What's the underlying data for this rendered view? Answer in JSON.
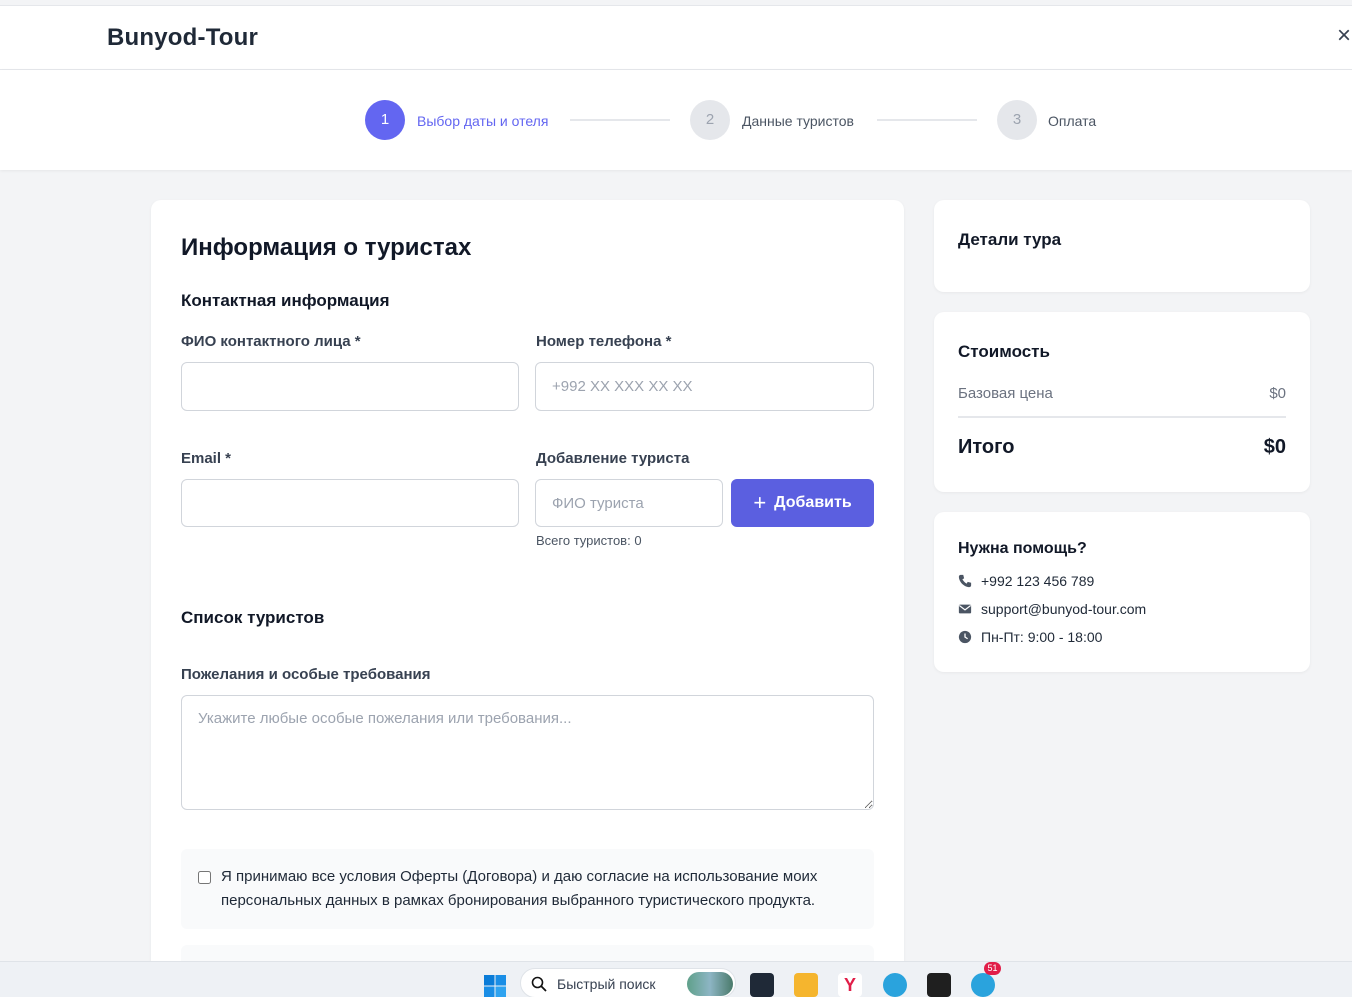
{
  "header": {
    "brand": "Bunyod-Tour",
    "close_icon": "×"
  },
  "stepper": {
    "steps": [
      {
        "number": "1",
        "label": "Выбор даты и отеля",
        "state": "active"
      },
      {
        "number": "2",
        "label": "Данные туристов",
        "state": "inactive"
      },
      {
        "number": "3",
        "label": "Оплата",
        "state": "inactive"
      }
    ]
  },
  "form": {
    "title": "Информация о туристах",
    "contact_heading": "Контактная информация",
    "fio_label": "ФИО контактного лица *",
    "fio_value": "",
    "phone_label": "Номер телефона *",
    "phone_placeholder": "+992 XX XXX XX XX",
    "email_label": "Email *",
    "email_value": "",
    "add_tourist_label": "Добавление туриста",
    "tourist_name_placeholder": "ФИО туриста",
    "add_button": "Добавить",
    "total_tourists": "Всего туристов: 0",
    "tourists_list_heading": "Список туристов",
    "wishes_label": "Пожелания и особые требования",
    "wishes_placeholder": "Укажите любые особые пожелания или требования...",
    "terms_text": "Я принимаю все условия Оферты (Договора) и даю согласие на использование моих персональных данных в рамках бронирования выбранного туристического продукта.",
    "terms_checked": false
  },
  "tour_details": {
    "title": "Детали тура"
  },
  "pricing": {
    "title": "Стоимость",
    "base_label": "Базовая цена",
    "base_value": "$0",
    "total_label": "Итого",
    "total_value": "$0"
  },
  "help": {
    "title": "Нужна помощь?",
    "phone": "+992 123 456 789",
    "email": "support@bunyod-tour.com",
    "hours": "Пн-Пт: 9:00 - 18:00"
  },
  "taskbar": {
    "search_text": "Быстрый поиск",
    "telegram_badge": "51"
  },
  "colors": {
    "accent": "#5b5fe0",
    "step_active": "#6366f1",
    "background": "#f3f4f6"
  }
}
